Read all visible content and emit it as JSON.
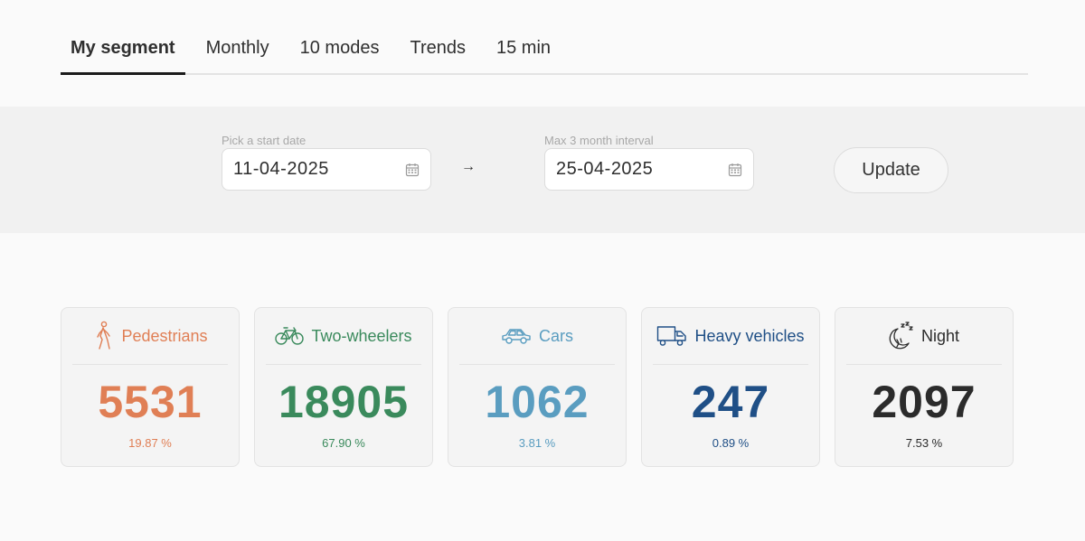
{
  "tabs": [
    {
      "label": "My segment",
      "active": true
    },
    {
      "label": "Monthly",
      "active": false
    },
    {
      "label": "10 modes",
      "active": false
    },
    {
      "label": "Trends",
      "active": false
    },
    {
      "label": "15 min",
      "active": false
    }
  ],
  "date_range": {
    "start_label": "Pick a start date",
    "start_value": "11-04-2025",
    "end_label": "Max 3 month interval",
    "end_value": "25-04-2025",
    "arrow": "→",
    "update_label": "Update"
  },
  "cards": [
    {
      "label": "Pedestrians",
      "value": "5531",
      "percent": "19.87 %",
      "color": "#e07f55",
      "icon": "pedestrian-icon"
    },
    {
      "label": "Two-wheelers",
      "value": "18905",
      "percent": "67.90 %",
      "color": "#3a8a5c",
      "icon": "bicycle-icon"
    },
    {
      "label": "Cars",
      "value": "1062",
      "percent": "3.81 %",
      "color": "#5a9dc0",
      "icon": "car-icon"
    },
    {
      "label": "Heavy vehicles",
      "value": "247",
      "percent": "0.89 %",
      "color": "#1f4f86",
      "icon": "truck-icon"
    },
    {
      "label": "Night",
      "value": "2097",
      "percent": "7.53 %",
      "color": "#2b2b2b",
      "icon": "night-icon"
    }
  ]
}
